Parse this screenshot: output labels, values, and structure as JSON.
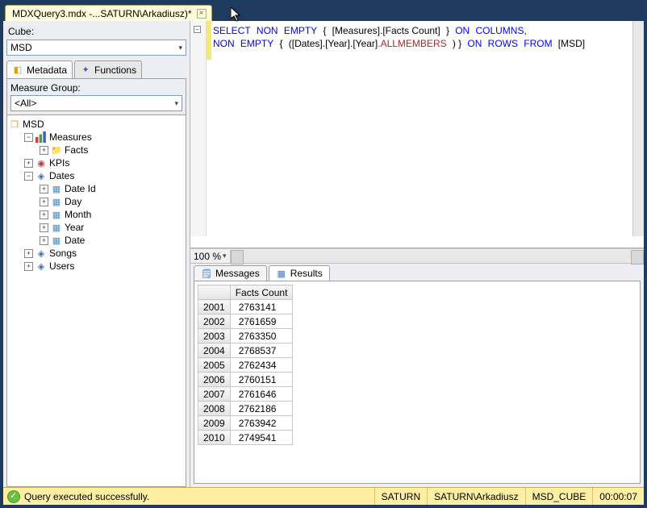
{
  "tab": {
    "title": "MDXQuery3.mdx -...SATURN\\Arkadiusz)*"
  },
  "left": {
    "cube_label": "Cube:",
    "cube_value": "MSD",
    "subtabs": {
      "metadata": "Metadata",
      "functions": "Functions"
    },
    "mg_label": "Measure Group:",
    "mg_value": "<All>",
    "tree": {
      "root": "MSD",
      "measures": "Measures",
      "facts": "Facts",
      "kpis": "KPIs",
      "dates": "Dates",
      "date_attrs": [
        "Date Id",
        "Day",
        "Month",
        "Year",
        "Date"
      ],
      "songs": "Songs",
      "users": "Users"
    }
  },
  "editor": {
    "tokens": {
      "select": "SELECT",
      "non": "NON",
      "empty": "EMPTY",
      "meas": "[Measures].[Facts Count]",
      "on": "ON",
      "columns": "COLUMNS",
      "dates": "([Dates].[Year].[Year]",
      "allm": ".ALLMEMBERS",
      "rows": "ROWS",
      "from": "FROM",
      "msd": "[MSD]"
    },
    "zoom": "100 %"
  },
  "results": {
    "tabs": {
      "messages": "Messages",
      "results": "Results"
    },
    "header": "Facts Count",
    "rows": [
      {
        "y": "2001",
        "v": "2763141"
      },
      {
        "y": "2002",
        "v": "2761659"
      },
      {
        "y": "2003",
        "v": "2763350"
      },
      {
        "y": "2004",
        "v": "2768537"
      },
      {
        "y": "2005",
        "v": "2762434"
      },
      {
        "y": "2006",
        "v": "2760151"
      },
      {
        "y": "2007",
        "v": "2761646"
      },
      {
        "y": "2008",
        "v": "2762186"
      },
      {
        "y": "2009",
        "v": "2763942"
      },
      {
        "y": "2010",
        "v": "2749541"
      }
    ]
  },
  "status": {
    "msg": "Query executed successfully.",
    "server": "SATURN",
    "user": "SATURN\\Arkadiusz",
    "db": "MSD_CUBE",
    "time": "00:00:07"
  },
  "chart_data": {
    "type": "table",
    "title": "Facts Count by Year",
    "columns": [
      "Year",
      "Facts Count"
    ],
    "rows": [
      [
        "2001",
        2763141
      ],
      [
        "2002",
        2761659
      ],
      [
        "2003",
        2763350
      ],
      [
        "2004",
        2768537
      ],
      [
        "2005",
        2762434
      ],
      [
        "2006",
        2760151
      ],
      [
        "2007",
        2761646
      ],
      [
        "2008",
        2762186
      ],
      [
        "2009",
        2763942
      ],
      [
        "2010",
        2749541
      ]
    ]
  }
}
